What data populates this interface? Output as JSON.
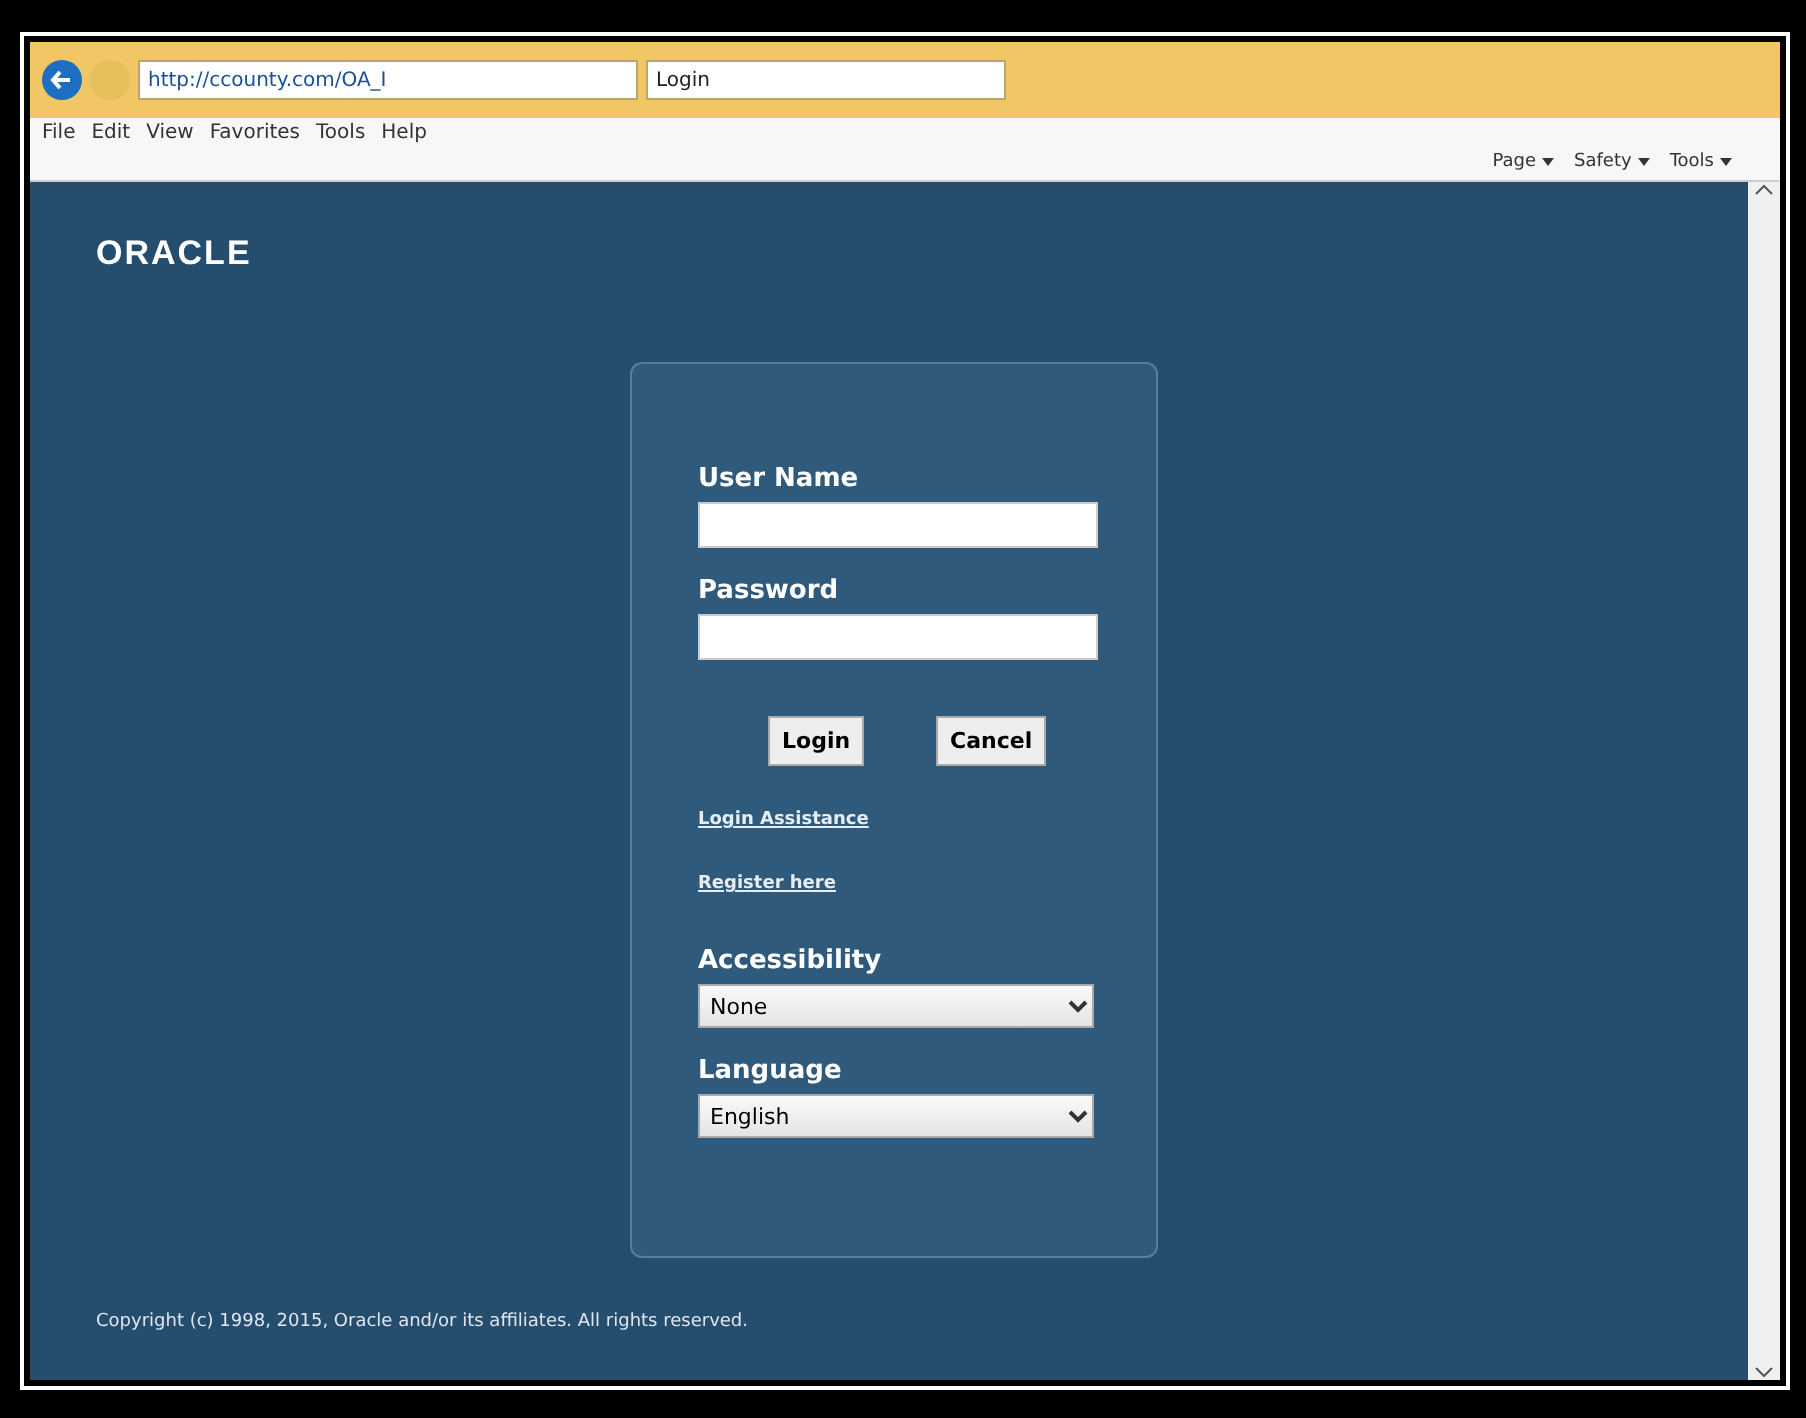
{
  "browser": {
    "address": "http://ccounty.com/OA_I",
    "tab_title": "Login",
    "menu": [
      "File",
      "Edit",
      "View",
      "Favorites",
      "Tools",
      "Help"
    ],
    "commands": [
      "Page",
      "Safety",
      "Tools"
    ]
  },
  "logo": "ORACLE",
  "form": {
    "username_label": "User Name",
    "password_label": "Password",
    "buttons": [
      "Login",
      "Cancel"
    ],
    "links": [
      "Login Assistance",
      "Register here"
    ],
    "selects": [
      {
        "label": "Accessibility",
        "value": "None"
      },
      {
        "label": "Language",
        "value": "English"
      }
    ]
  },
  "copyright": "Copyright (c) 1998, 2015, Oracle and/or its affiliates. All rights reserved."
}
